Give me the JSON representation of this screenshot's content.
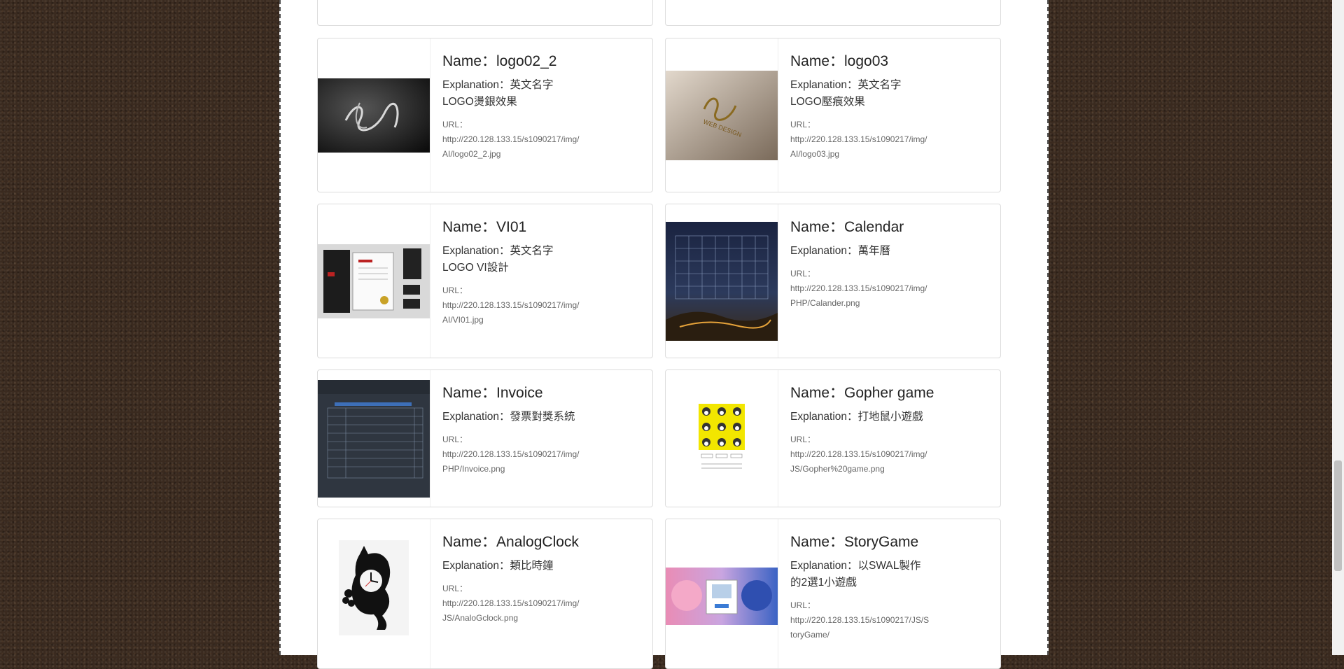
{
  "cards": [
    {
      "name": "Name：logo02_2",
      "explanation": "Explanation：英文名字\nLOGO燙銀效果",
      "url_label": "URL：",
      "url": "http://220.128.133.15/s1090217/img/AI/logo02_2.jpg"
    },
    {
      "name": "Name：logo03",
      "explanation": "Explanation：英文名字\nLOGO壓痕效果",
      "url_label": "URL：",
      "url": "http://220.128.133.15/s1090217/img/AI/logo03.jpg"
    },
    {
      "name": "Name：VI01",
      "explanation": "Explanation：英文名字\nLOGO VI設計",
      "url_label": "URL：",
      "url": "http://220.128.133.15/s1090217/img/AI/VI01.jpg"
    },
    {
      "name": "Name：Calendar",
      "explanation": "Explanation：萬年曆",
      "url_label": "URL：",
      "url": "http://220.128.133.15/s1090217/img/PHP/Calander.png"
    },
    {
      "name": "Name：Invoice",
      "explanation": "Explanation：發票對獎系統",
      "url_label": "URL：",
      "url": "http://220.128.133.15/s1090217/img/PHP/Invoice.png"
    },
    {
      "name": "Name：Gopher game",
      "explanation": "Explanation：打地鼠小遊戲",
      "url_label": "URL：",
      "url": "http://220.128.133.15/s1090217/img/JS/Gopher%20game.png"
    },
    {
      "name": "Name：AnalogClock",
      "explanation": "Explanation：類比時鐘",
      "url_label": "URL：",
      "url": "http://220.128.133.15/s1090217/img/JS/AnaloGclock.png"
    },
    {
      "name": "Name：StoryGame",
      "explanation": "Explanation：以SWAL製作\n的2選1小遊戲",
      "url_label": "URL：",
      "url": "http://220.128.133.15/s1090217/JS/StoryGame/"
    }
  ],
  "thumbnail_icons": [
    "logo-silver-icon",
    "logo-emboss-icon",
    "vi-stationery-icon",
    "calendar-night-icon",
    "invoice-table-icon",
    "gopher-grid-icon",
    "cat-clock-icon",
    "anime-story-icon"
  ],
  "colors": {
    "panel": "#ffffff",
    "border": "#dcdcdc",
    "text": "#222222",
    "muted": "#666666"
  }
}
